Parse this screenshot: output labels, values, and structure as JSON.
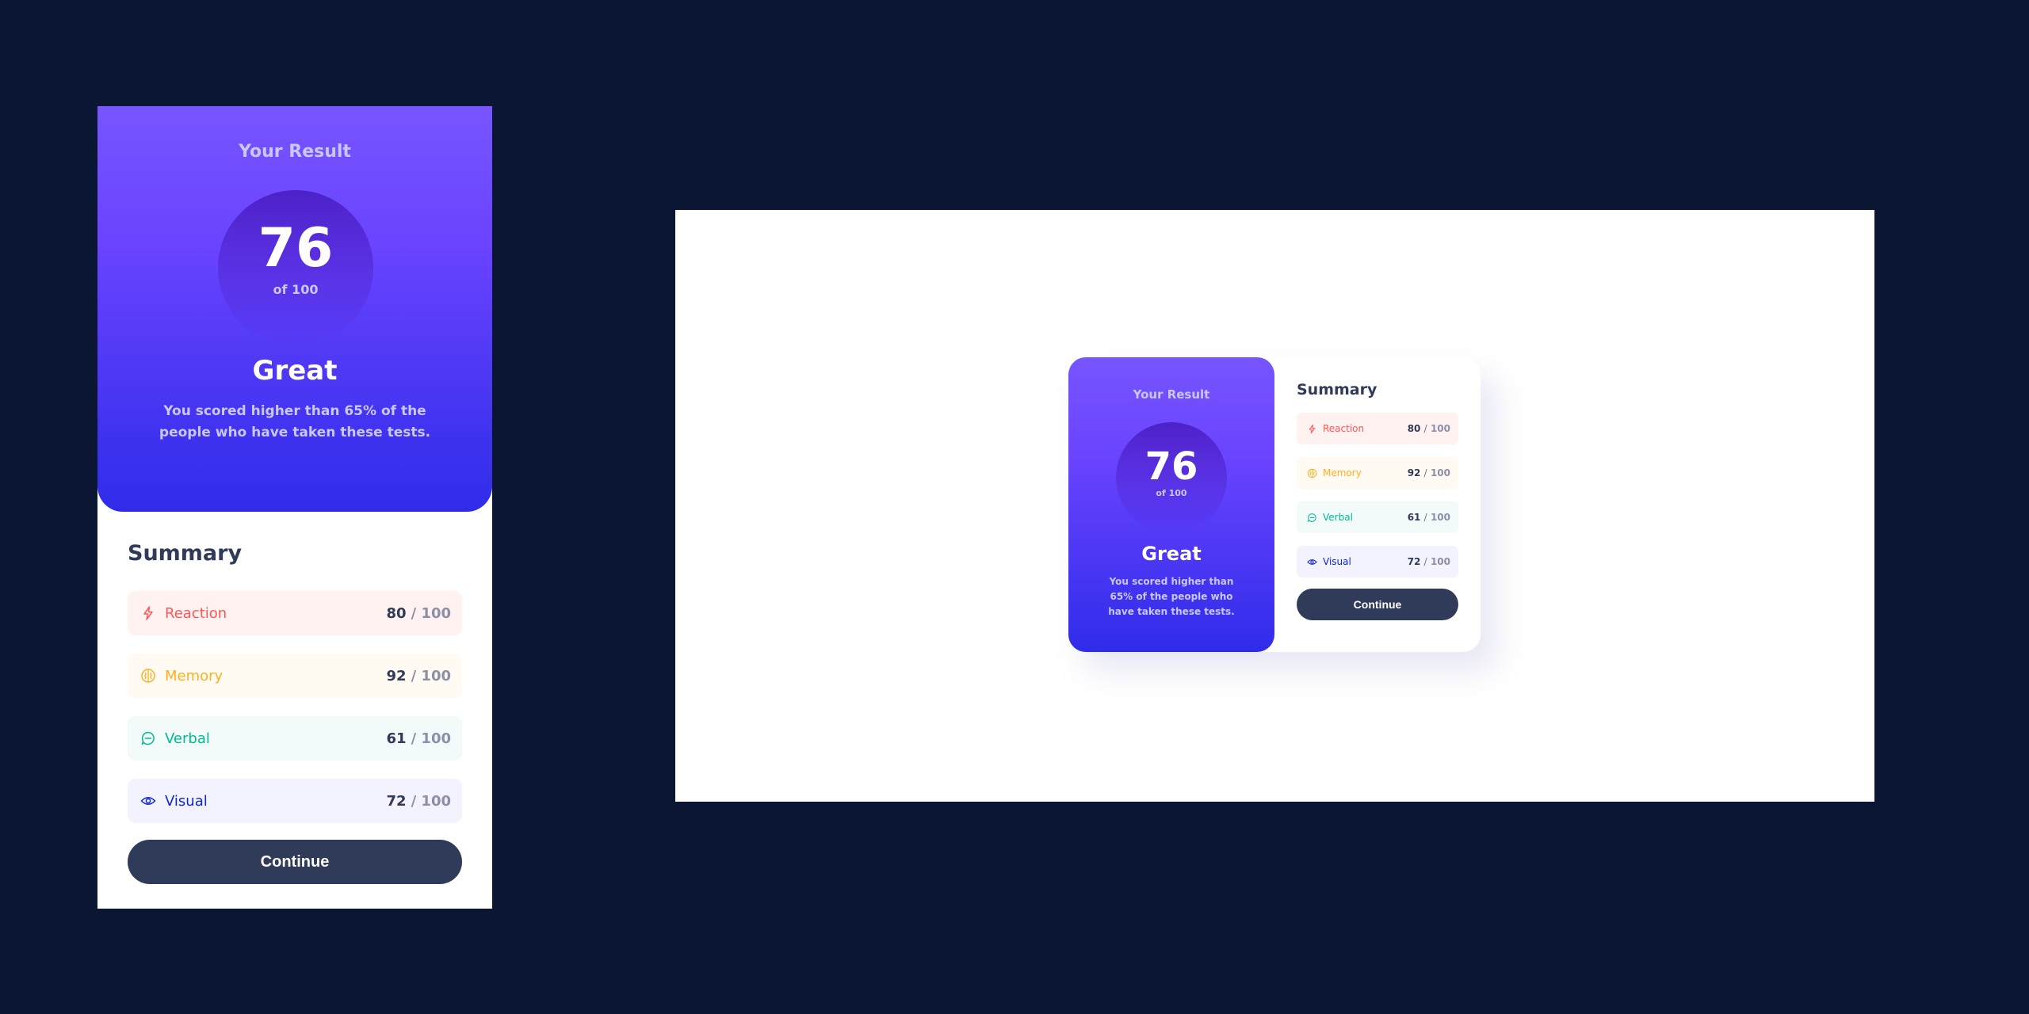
{
  "result": {
    "heading": "Your Result",
    "score": "76",
    "out_of": "of 100",
    "rating": "Great",
    "description": "You scored higher than 65% of the people who have taken these tests."
  },
  "summary": {
    "title": "Summary",
    "separator": "/ 100",
    "items": [
      {
        "label": "Reaction",
        "score": "80",
        "icon": "lightning-icon",
        "color": "#ff5757",
        "bg": "#fff2f1"
      },
      {
        "label": "Memory",
        "score": "92",
        "icon": "brain-icon",
        "color": "#ffb01f",
        "bg": "#fffaf2"
      },
      {
        "label": "Verbal",
        "score": "61",
        "icon": "speech-bubble-icon",
        "color": "#00bb8f",
        "bg": "#f2fbfa"
      },
      {
        "label": "Visual",
        "score": "72",
        "icon": "eye-icon",
        "color": "#1125d6",
        "bg": "#f2f3fe"
      }
    ]
  },
  "button": {
    "label": "Continue"
  },
  "colors": {
    "background": "#0b1732",
    "gradient_top": "#7755ff",
    "gradient_bottom": "#2f2ce9",
    "dark_text": "#303b59"
  }
}
